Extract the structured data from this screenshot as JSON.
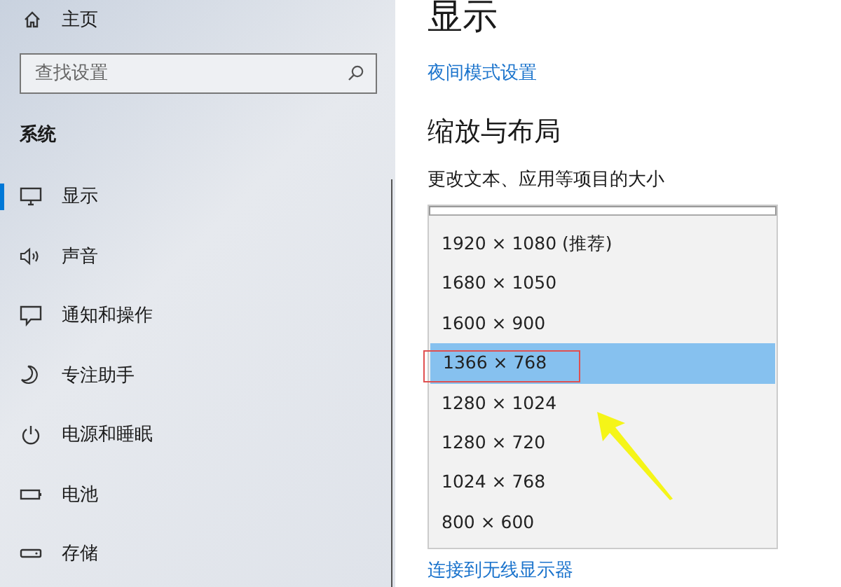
{
  "sidebar": {
    "home": "主页",
    "search": {
      "placeholder": "查找设置"
    },
    "section": "系统",
    "items": [
      {
        "label": "显示",
        "selected": true
      },
      {
        "label": "声音",
        "selected": false
      },
      {
        "label": "通知和操作",
        "selected": false
      },
      {
        "label": "专注助手",
        "selected": false
      },
      {
        "label": "电源和睡眠",
        "selected": false
      },
      {
        "label": "电池",
        "selected": false
      },
      {
        "label": "存储",
        "selected": false
      }
    ]
  },
  "main": {
    "title": "显示",
    "night_link": "夜间模式设置",
    "heading": "缩放与布局",
    "label": "更改文本、应用等项目的大小",
    "options": [
      {
        "label": "1920 × 1080 (推荐)",
        "selected": false
      },
      {
        "label": "1680 × 1050",
        "selected": false
      },
      {
        "label": "1600 × 900",
        "selected": false
      },
      {
        "label": "1366 × 768",
        "selected": true
      },
      {
        "label": "1280 × 1024",
        "selected": false
      },
      {
        "label": "1280 × 720",
        "selected": false
      },
      {
        "label": "1024 × 768",
        "selected": false
      },
      {
        "label": "800 × 600",
        "selected": false
      }
    ],
    "bottom_link": "连接到无线显示器"
  }
}
